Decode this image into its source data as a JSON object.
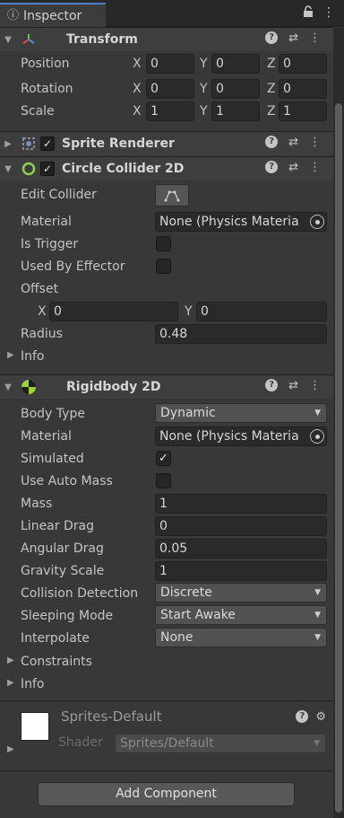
{
  "tab": {
    "title": "Inspector"
  },
  "transform": {
    "title": "Transform",
    "rows": [
      {
        "label": "Position",
        "x": "0",
        "y": "0",
        "z": "0"
      },
      {
        "label": "Rotation",
        "x": "0",
        "y": "0",
        "z": "0"
      },
      {
        "label": "Scale",
        "x": "1",
        "y": "1",
        "z": "1"
      }
    ],
    "axes": {
      "x": "X",
      "y": "Y",
      "z": "Z"
    }
  },
  "sprite_renderer": {
    "title": "Sprite Renderer",
    "enabled": "✓"
  },
  "circle_collider": {
    "title": "Circle Collider 2D",
    "enabled": "✓",
    "edit_collider_label": "Edit Collider",
    "material_label": "Material",
    "material_value": "None (Physics Materia",
    "is_trigger_label": "Is Trigger",
    "used_by_effector_label": "Used By Effector",
    "offset_label": "Offset",
    "offset_x": "0",
    "offset_y": "0",
    "radius_label": "Radius",
    "radius_value": "0.48",
    "info_label": "Info"
  },
  "rigidbody": {
    "title": "Rigidbody 2D",
    "body_type_label": "Body Type",
    "body_type_value": "Dynamic",
    "material_label": "Material",
    "material_value": "None (Physics Materia",
    "simulated_label": "Simulated",
    "simulated_check": "✓",
    "use_auto_mass_label": "Use Auto Mass",
    "mass_label": "Mass",
    "mass_value": "1",
    "linear_drag_label": "Linear Drag",
    "linear_drag_value": "0",
    "angular_drag_label": "Angular Drag",
    "angular_drag_value": "0.05",
    "gravity_scale_label": "Gravity Scale",
    "gravity_scale_value": "1",
    "collision_detection_label": "Collision Detection",
    "collision_detection_value": "Discrete",
    "sleeping_mode_label": "Sleeping Mode",
    "sleeping_mode_value": "Start Awake",
    "interpolate_label": "Interpolate",
    "interpolate_value": "None",
    "constraints_label": "Constraints",
    "info_label": "Info"
  },
  "material_block": {
    "name": "Sprites-Default",
    "shader_label": "Shader",
    "shader_value": "Sprites/Default"
  },
  "add_component_label": "Add Component"
}
